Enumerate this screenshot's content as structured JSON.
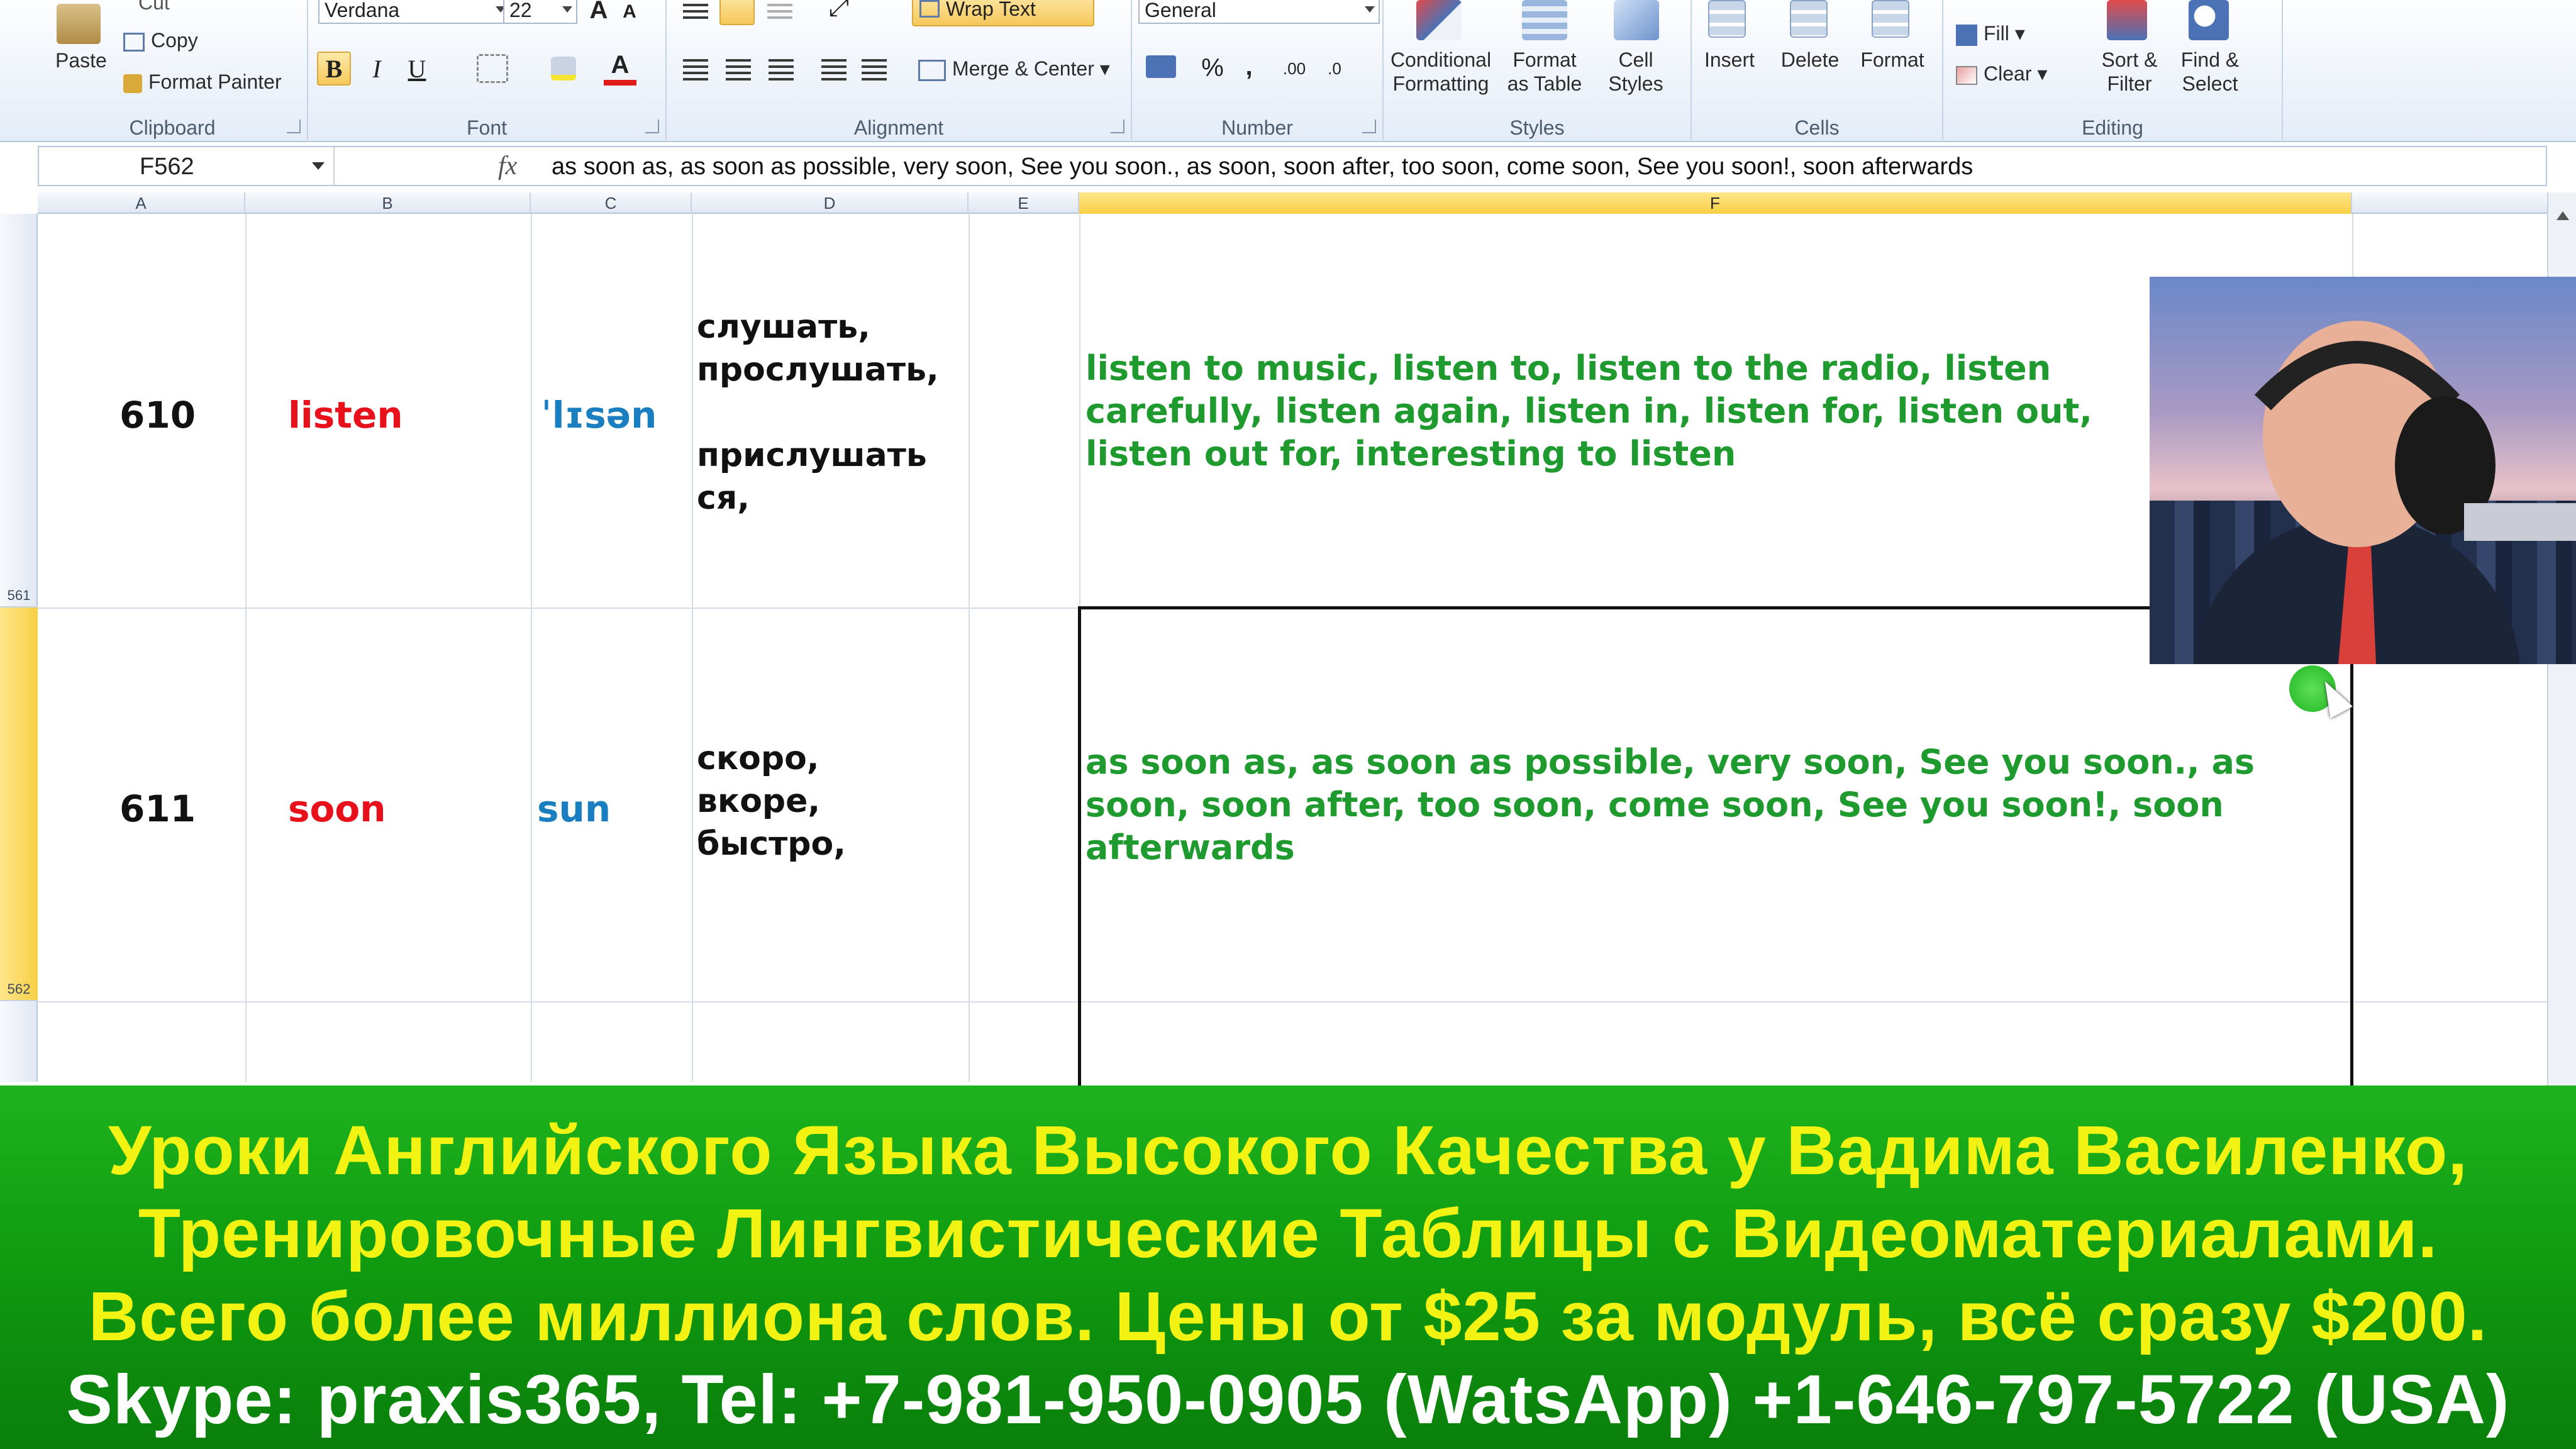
{
  "ribbon": {
    "clipboard": {
      "cut": "Cut",
      "copy": "Copy",
      "paste": "Paste",
      "format_painter": "Format Painter",
      "label": "Clipboard"
    },
    "font": {
      "name": "Verdana",
      "size": "22",
      "bold": "B",
      "italic": "I",
      "underline": "U",
      "grow": "A",
      "shrink": "A",
      "font_color": "A",
      "label": "Font"
    },
    "alignment": {
      "wrap_text": "Wrap Text",
      "merge_center": "Merge & Center",
      "label": "Alignment"
    },
    "number": {
      "format": "General",
      "percent": "%",
      "comma": ",",
      "increase_decimal": ".00",
      "decrease_decimal": ".0",
      "label": "Number"
    },
    "styles": {
      "conditional_1": "Conditional",
      "conditional_2": "Formatting",
      "table_1": "Format",
      "table_2": "as Table",
      "cell_1": "Cell",
      "cell_2": "Styles",
      "label": "Styles"
    },
    "cells": {
      "insert": "Insert",
      "delete": "Delete",
      "format": "Format",
      "label": "Cells"
    },
    "editing": {
      "fill": "Fill",
      "clear": "Clear",
      "sort_1": "Sort &",
      "sort_2": "Filter",
      "find_1": "Find &",
      "find_2": "Select",
      "label": "Editing"
    }
  },
  "formula_bar": {
    "name_box": "F562",
    "fx": "fx",
    "formula": "as soon as, as soon as possible, very soon, See you soon., as soon, soon after, too soon, come soon, See you soon!, soon afterwards"
  },
  "columns": [
    "A",
    "B",
    "C",
    "D",
    "E",
    "F"
  ],
  "rows": [
    {
      "row_number": "561",
      "num": "610",
      "word": "listen",
      "ipa": "ˈlɪsən",
      "russian": "слушать,\nпрослушать,\n\nприслушать\nся,",
      "phrases": "listen to music, listen to, listen to the radio, listen carefully, listen again, listen in, listen for, listen out, listen out for, interesting to listen"
    },
    {
      "row_number": "562",
      "num": "611",
      "word": "soon",
      "ipa": "sun",
      "russian": "скоро,\nвкоре,\nбыстро,",
      "phrases": "as soon as, as soon as possible, very soon, See you soon., as soon, soon after, too soon, come soon, See you soon!, soon afterwards"
    }
  ],
  "banner": {
    "line1": "Уроки Английского Языка Высокого Качества у Вадима Василенко,",
    "line2": "Тренировочные Лингвистические Таблицы с Видеоматериалами.",
    "line3": "Всего более миллиона слов. Цены от $25 за модуль, всё сразу $200.",
    "line4": "Skype: praxis365, Tel: +7-981-950-0905 (WatsApp) +1-646-797-5722 (USA)"
  },
  "colors": {
    "word": "#e8111b",
    "ipa": "#1a7fc0",
    "phrases": "#1f9a2f",
    "banner_green": "#0f9a10",
    "banner_yellow": "#f3f313"
  }
}
